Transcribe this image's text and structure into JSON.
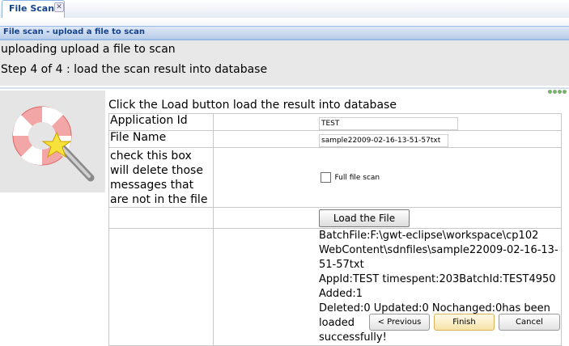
{
  "tab": {
    "label": "File Scan"
  },
  "panel": {
    "title": "File scan - upload a file to scan"
  },
  "header": {
    "subtitle": "uploading upload a file to scan",
    "step": "Step 4 of 4 : load the scan result into database"
  },
  "main": {
    "instruction": "Click the Load button load the result into database",
    "form": {
      "app_id_label": "Application Id",
      "app_id_value": "TEST",
      "file_name_label": "File Name",
      "file_name_value": "sample22009-02-16-13-51-57txt",
      "checkbox_help_label": "check this box will delete those messages that are not in the file",
      "full_scan_label": "Full file scan",
      "load_button": "Load the File",
      "result_lines": [
        "BatchFile:F:\\gwt-eclipse\\workspace\\cp102",
        "WebContent\\sdnfiles\\sample22009-02-16-13-51-57txt",
        "AppId:TEST timespent:203BatchId:TEST4950 Added:1",
        "Deleted:0 Updated:0 Nochanged:0has been loaded",
        "successfully!"
      ]
    }
  },
  "footer": {
    "previous": "< Previous",
    "finish": "Finish",
    "cancel": "Cancel"
  },
  "icons": {
    "tab_close": "close-icon",
    "logo": "lifebuoy-magnifier-star-icon"
  },
  "colors": {
    "title_text": "#15428b",
    "title_bar": "#c5d8f0",
    "header_bg": "#e8e8e8"
  }
}
